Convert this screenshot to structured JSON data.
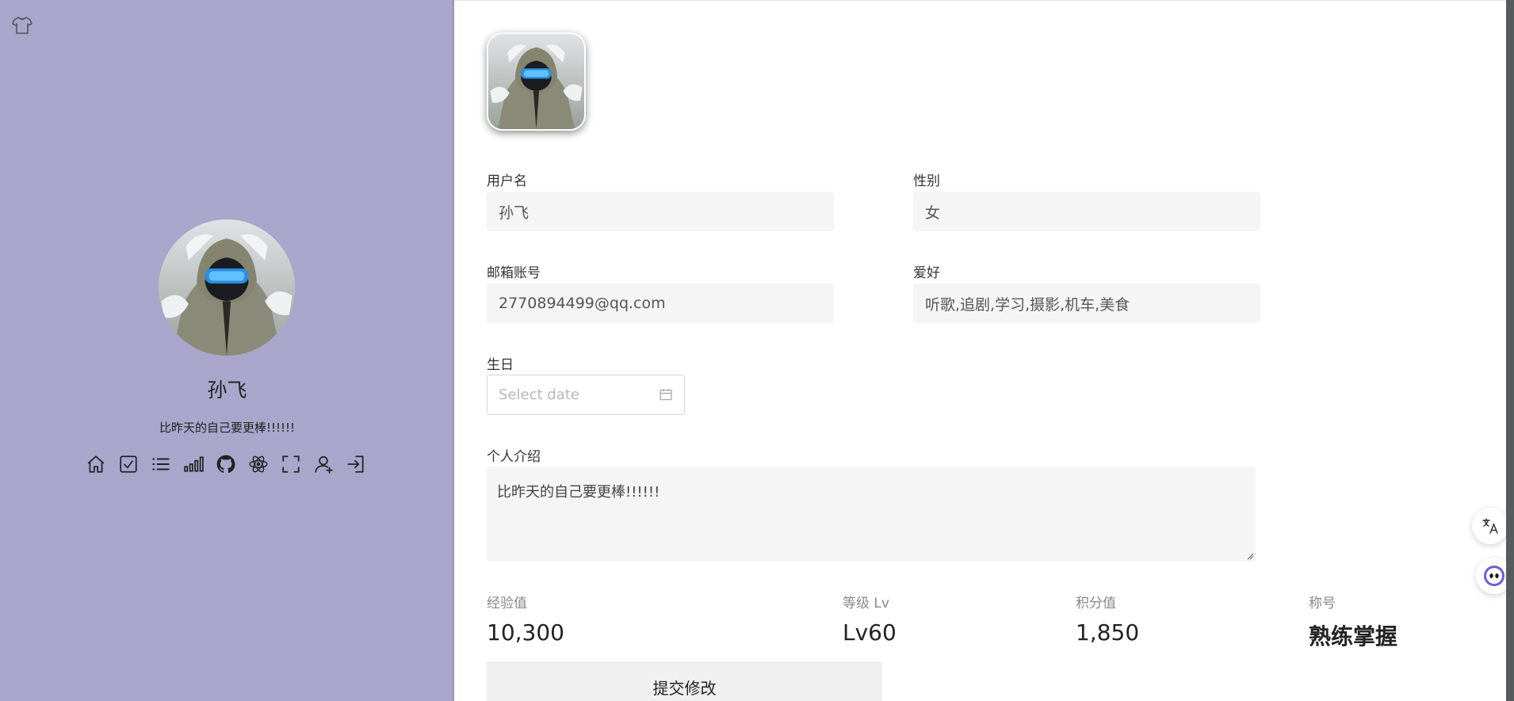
{
  "sidebar": {
    "name": "孙飞",
    "motto": "比昨天的自己要更棒!!!!!!",
    "icons": [
      "home-icon",
      "checkbox-icon",
      "list-icon",
      "signal-bars-icon",
      "github-icon",
      "react-icon",
      "fullscreen-icon",
      "add-user-icon",
      "logout-icon"
    ],
    "background": "#aaa5cb"
  },
  "form": {
    "username_label": "用户名",
    "username_value": "孙飞",
    "gender_label": "性别",
    "gender_value": "女",
    "email_label": "邮箱账号",
    "email_value": "2770894499@qq.com",
    "hobby_label": "爱好",
    "hobby_value": "听歌,追剧,学习,摄影,机车,美食",
    "birthday_label": "生日",
    "birthday_placeholder": "Select date",
    "intro_label": "个人介绍",
    "intro_value": "比昨天的自己要更棒!!!!!!"
  },
  "stats": [
    {
      "label": "经验值",
      "value": "10,300"
    },
    {
      "label": "等级 Lv",
      "value": "Lv60"
    },
    {
      "label": "积分值",
      "value": "1,850"
    },
    {
      "label": "称号",
      "value": "熟练掌握"
    }
  ],
  "submit_label": "提交修改"
}
